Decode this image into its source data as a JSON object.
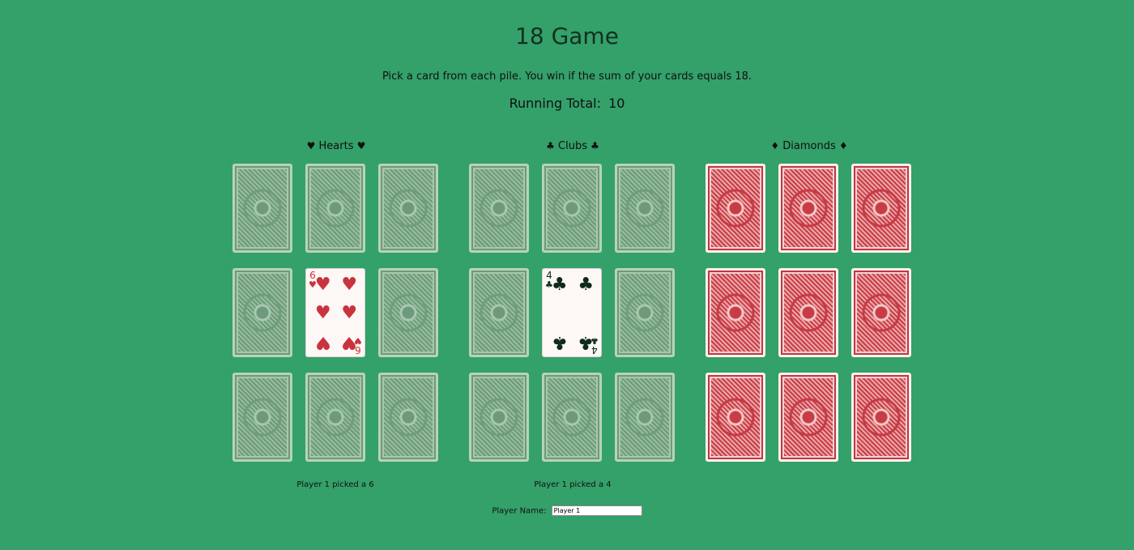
{
  "title": "18 Game",
  "instructions": "Pick a card from each pile. You win if the sum of your cards equals 18.",
  "running_total": {
    "label": "Running Total:",
    "value": "10"
  },
  "colors": {
    "table": "#34a06a",
    "green_back": "#7fa98a",
    "red_back": "#d24a52",
    "hearts": "#c8343e",
    "clubs": "#0f2a1a"
  },
  "piles": [
    {
      "name": "Hearts",
      "symbol": "♥",
      "back": "green",
      "revealed": {
        "index": 4,
        "rank": "6",
        "suit": "♥",
        "color": "red"
      },
      "message": "Player 1 picked a 6"
    },
    {
      "name": "Clubs",
      "symbol": "♣",
      "back": "green",
      "revealed": {
        "index": 4,
        "rank": "4",
        "suit": "♣",
        "color": "black"
      },
      "message": "Player 1 picked a 4"
    },
    {
      "name": "Diamonds",
      "symbol": "♦",
      "back": "red",
      "revealed": null,
      "message": ""
    }
  ],
  "player": {
    "label": "Player Name:",
    "value": "Player 1"
  }
}
